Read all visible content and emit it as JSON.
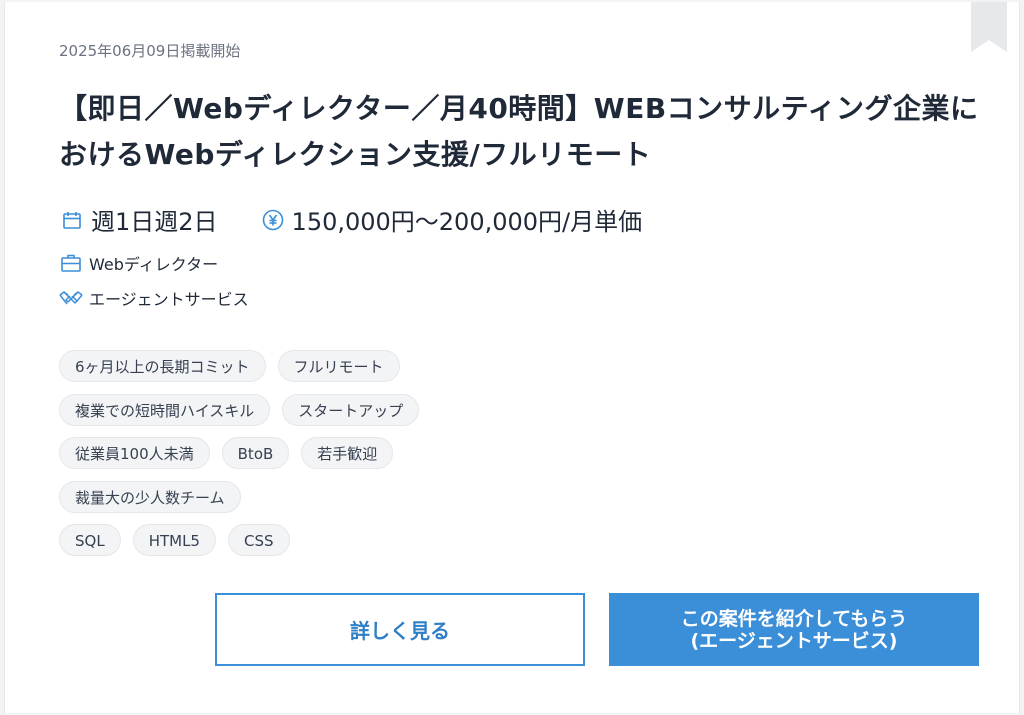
{
  "listing": {
    "posted_date": "2025年06月09日掲載開始",
    "title": "【即日／Webディレクター／月40時間】WEBコンサルティング企業におけるWebディレクション支援/フルリモート",
    "schedule": "週1日週2日",
    "price": "150,000円〜200,000円/月単価",
    "role": "Webディレクター",
    "service": "エージェントサービス",
    "tags": [
      [
        "6ヶ月以上の長期コミット",
        "フルリモート"
      ],
      [
        "複業での短時間ハイスキル",
        "スタートアップ"
      ],
      [
        "従業員100人未満",
        "BtoB",
        "若手歓迎"
      ],
      [
        "裁量大の少人数チーム"
      ],
      [
        "SQL",
        "HTML5",
        "CSS"
      ]
    ]
  },
  "actions": {
    "detail_label": "詳しく見る",
    "agent_label_line1": "この案件を紹介してもらう",
    "agent_label_line2": "(エージェントサービス)"
  },
  "icons": {
    "bookmark": "bookmark-icon",
    "calendar": "calendar-icon",
    "yen": "yen-icon",
    "briefcase": "briefcase-icon",
    "handshake": "handshake-icon"
  },
  "colors": {
    "accent": "#3b8ed8",
    "icon": "#3b8ed8",
    "tag_bg": "#f3f4f6",
    "muted_text": "#6b7280"
  }
}
